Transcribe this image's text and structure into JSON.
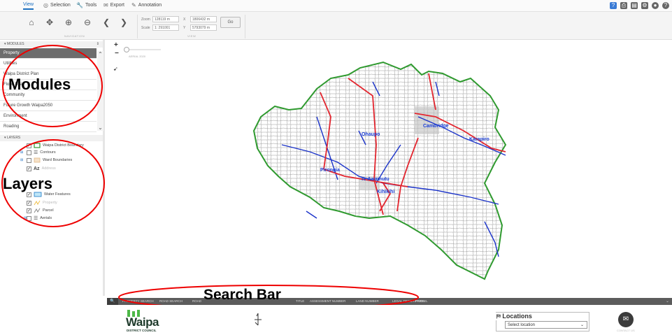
{
  "tabs": [
    {
      "label": "View",
      "icon": ""
    },
    {
      "label": "Selection",
      "icon": "selection-icon"
    },
    {
      "label": "Tools",
      "icon": "wrench-icon"
    },
    {
      "label": "Export",
      "icon": "envelope-icon"
    },
    {
      "label": "Annotation",
      "icon": "pencil-icon"
    }
  ],
  "ribbon": {
    "navigation_label": "NAVIGATION",
    "zoom_label": "Zoom",
    "zoom_value": "128119 m",
    "scale_label": "Scale",
    "scale_value": "1: 291001",
    "x_label": "X",
    "x_value": "1806432 m",
    "y_label": "Y",
    "y_value": "5793079 m",
    "go_label": "Go",
    "view_label": "VIEW"
  },
  "modules": {
    "header": "MODULES",
    "items": [
      "Property",
      "Utilities",
      "Waipa District Plan",
      "Flood Risk",
      "Community",
      "Future Growth Waipa2050",
      "Environment",
      "Roading"
    ]
  },
  "layers": {
    "header": "LAYERS",
    "items": [
      {
        "label": "Waipa District Boundary",
        "checked": true
      },
      {
        "label": "Contours",
        "checked": false
      },
      {
        "label": "Ward Boundaries",
        "checked": false
      },
      {
        "label": "Address",
        "checked": true,
        "prefix": "Az"
      },
      {
        "label": "Water Features",
        "checked": true
      },
      {
        "label": "Property",
        "checked": true
      },
      {
        "label": "Parcel",
        "checked": true
      },
      {
        "label": "Aerials",
        "checked": false
      }
    ]
  },
  "map": {
    "aerial_label": "AERIAL 2020",
    "places": [
      "Ohaupo",
      "Cambridge",
      "Karapiro",
      "Pirongia",
      "Te Awamutu",
      "Kihikihi"
    ],
    "colors": {
      "boundary": "#2f9a2f",
      "roads": "#e3262f",
      "rivers": "#1b33c9",
      "parcels": "#9a9a9a",
      "labels": "#1a3fd6"
    }
  },
  "search": {
    "tabs": [
      "PROPERTY SEARCH",
      "ROAD SEARCH",
      "ROAD",
      "TITLE",
      "ASSESSMENT NUMBER",
      "LAND NUMBER",
      "LEGAL DESCRIPTION",
      "PARCEL"
    ]
  },
  "footer": {
    "logo_text": "Waipa",
    "logo_sub": "DISTRICT COUNCIL",
    "locations_label": "Locations",
    "select_placeholder": "Select location",
    "contact_label": "CONTACT US"
  },
  "annotations": {
    "modules": "Modules",
    "layers": "Layers",
    "search": "Search Bar"
  }
}
